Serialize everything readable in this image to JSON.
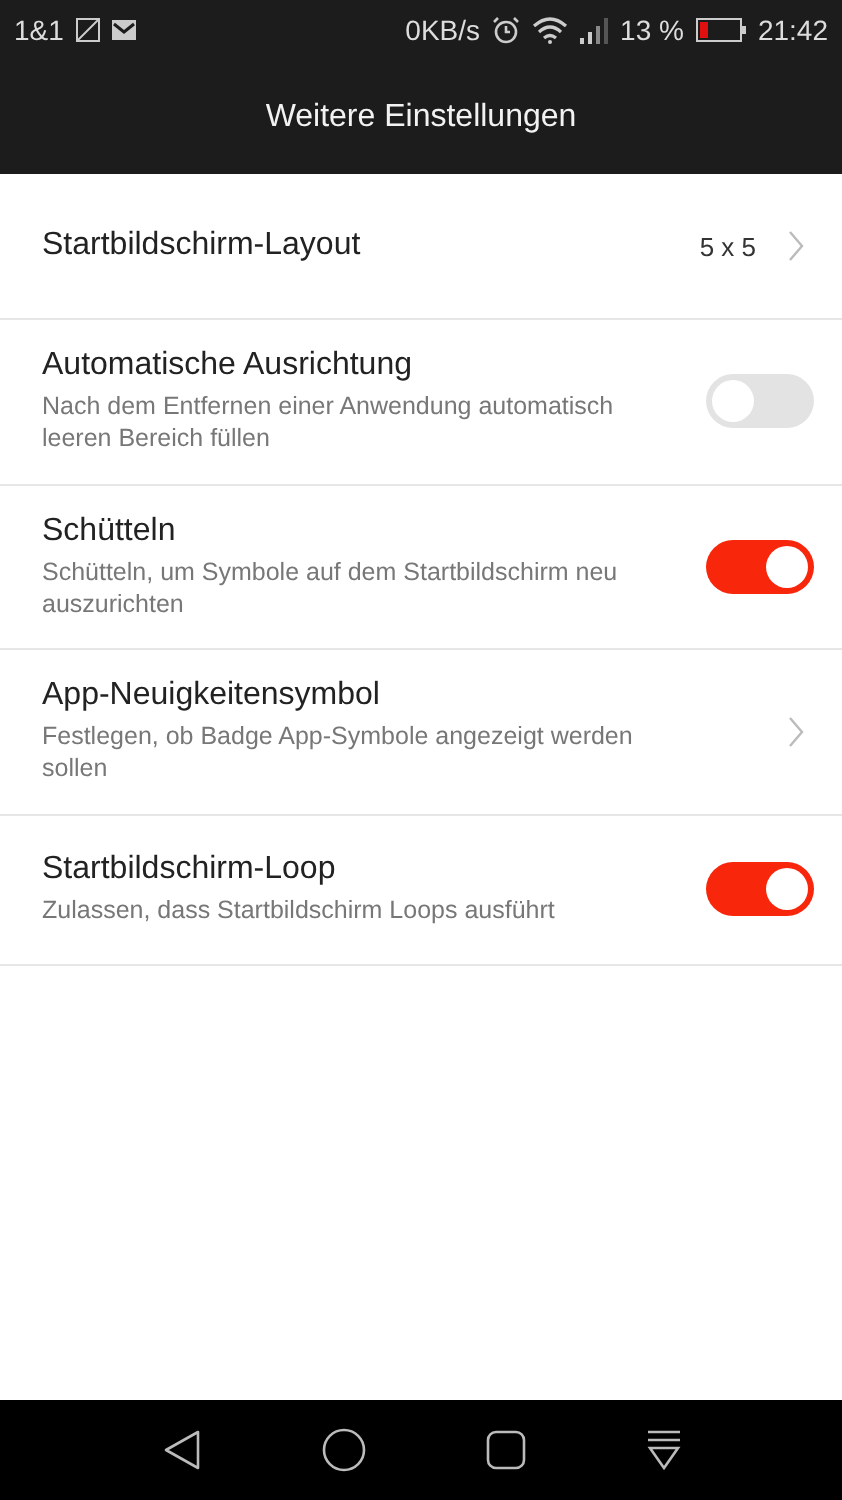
{
  "status_bar": {
    "carrier": "1&1",
    "speed": "0KB/s",
    "battery": "13 %",
    "time": "21:42"
  },
  "title": "Weitere Einstellungen",
  "settings": [
    {
      "kind": "link",
      "title": "Startbildschirm-Layout",
      "value": "5 x 5"
    },
    {
      "kind": "toggle",
      "title": "Automatische Ausrichtung",
      "description": "Nach dem Entfernen einer Anwendung automatisch leeren Bereich füllen",
      "on": false
    },
    {
      "kind": "toggle",
      "title": "Schütteln",
      "description": "Schütteln, um Symbole auf dem Startbildschirm neu auszurichten",
      "on": true
    },
    {
      "kind": "link",
      "title": "App-Neuigkeitensymbol",
      "description": "Festlegen, ob Badge App-Symbole angezeigt werden sollen"
    },
    {
      "kind": "toggle",
      "title": "Startbildschirm-Loop",
      "description": "Zulassen, dass Startbildschirm Loops ausführt",
      "on": true
    }
  ]
}
